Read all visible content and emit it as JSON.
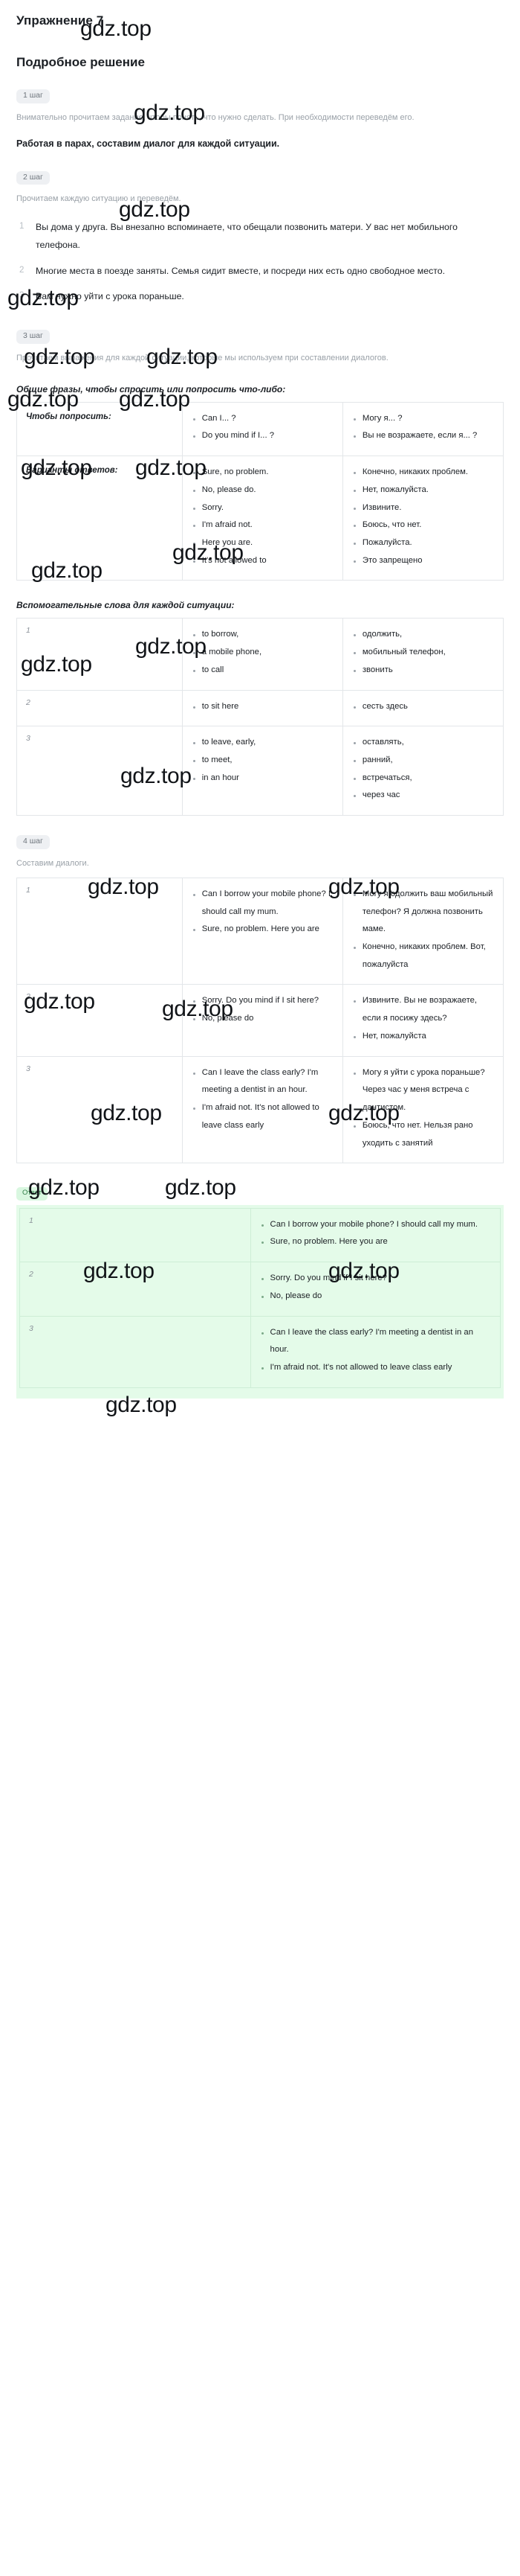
{
  "watermark": {
    "text": "gdz.top"
  },
  "header": {
    "exercise_title": "Упражнение 7",
    "solution_title": "Подробное решение"
  },
  "steps": [
    {
      "badge": "1 шаг",
      "instruction": "Внимательно прочитаем задание, чтобы понять, что нужно сделать. При необходимости переведём его.",
      "task_bold": "Работая в парах, составим диалог для каждой ситуации."
    },
    {
      "badge": "2 шаг",
      "instruction": "Прочитаем каждую ситуацию и переведём.",
      "situations": [
        "Вы дома у друга. Вы внезапно вспоминаете, что обещали позвонить матери. У вас нет мобильного телефона.",
        "Многие места в поезде заняты. Семья сидит вместе, и посреди них есть одно свободное место.",
        "Вам нужно уйти с урока пораньше."
      ]
    },
    {
      "badge": "3 шаг",
      "instruction": "Прочитаем выражения для каждой ситуации, которые мы используем при составлении диалогов.",
      "phrases_heading": "Общие фразы, чтобы спросить или попросить что-либо:",
      "phrases_table": [
        {
          "label": "Чтобы попросить:",
          "english": [
            "Can I... ?",
            "Do you mind if I... ?"
          ],
          "russian": [
            "Могу я... ?",
            "Вы не возражаете, если я... ?"
          ]
        },
        {
          "label": "Варианты ответов:",
          "english": [
            "Sure, no problem.",
            "No, please do.",
            "Sorry.",
            "I'm afraid not.",
            "Here you are.",
            "It's not allowed to"
          ],
          "russian": [
            "Конечно, никаких проблем.",
            "Нет, пожалуйста.",
            "Извините.",
            "Боюсь, что нет.",
            "Пожалуйста.",
            "Это запрещено"
          ]
        }
      ],
      "helpers_heading": "Вспомогательные слова для каждой ситуации:",
      "helpers_table": [
        {
          "index": "1",
          "english": [
            "to borrow,",
            "a mobile phone,",
            "to call"
          ],
          "russian": [
            "одолжить,",
            "мобильный телефон,",
            "звонить"
          ]
        },
        {
          "index": "2",
          "english": [
            "to sit here"
          ],
          "russian": [
            "сесть здесь"
          ]
        },
        {
          "index": "3",
          "english": [
            "to leave, early,",
            "to meet,",
            "in an hour"
          ],
          "russian": [
            "оставлять,",
            "ранний,",
            "встречаться,",
            "через час"
          ]
        }
      ]
    },
    {
      "badge": "4 шаг",
      "instruction": "Составим диалоги.",
      "dialogues_table": [
        {
          "index": "1",
          "english": [
            "Can I borrow your mobile phone? I should call my mum.",
            "Sure, no problem. Here you are"
          ],
          "russian": [
            "Могу я одолжить ваш мобильный телефон? Я должна позвонить маме.",
            "Конечно, никаких проблем. Вот, пожалуйста"
          ]
        },
        {
          "index": "2",
          "english": [
            "Sorry. Do you mind if I sit here?",
            "No, please do"
          ],
          "russian": [
            "Извините. Вы не возражаете, если я посижу здесь?",
            "Нет, пожалуйста"
          ]
        },
        {
          "index": "3",
          "english": [
            "Can I leave the class early? I'm meeting a dentist in an hour.",
            "I'm afraid not. It's not allowed to leave class early"
          ],
          "russian": [
            "Могу я уйти с урока пораньше? Через час у меня встреча с дантистом.",
            "Боюсь, что нет. Нельзя рано уходить с занятий"
          ]
        }
      ]
    }
  ],
  "answer": {
    "badge": "Ответ",
    "rows": [
      {
        "index": "1",
        "lines": [
          "Can I borrow your mobile phone? I should call my mum.",
          "Sure, no problem. Here you are"
        ]
      },
      {
        "index": "2",
        "lines": [
          "Sorry. Do you mind if I sit here?",
          "No, please do"
        ]
      },
      {
        "index": "3",
        "lines": [
          "Can I leave the class early? I'm meeting a dentist in an hour.",
          "I'm afraid not. It's not allowed to leave class early"
        ]
      }
    ]
  },
  "colors": {
    "answer_bg": "#e4fbe9",
    "answer_badge_bg": "#d9f7e0",
    "step_badge_bg": "#eef0f3",
    "border": "#e3e6e9"
  }
}
